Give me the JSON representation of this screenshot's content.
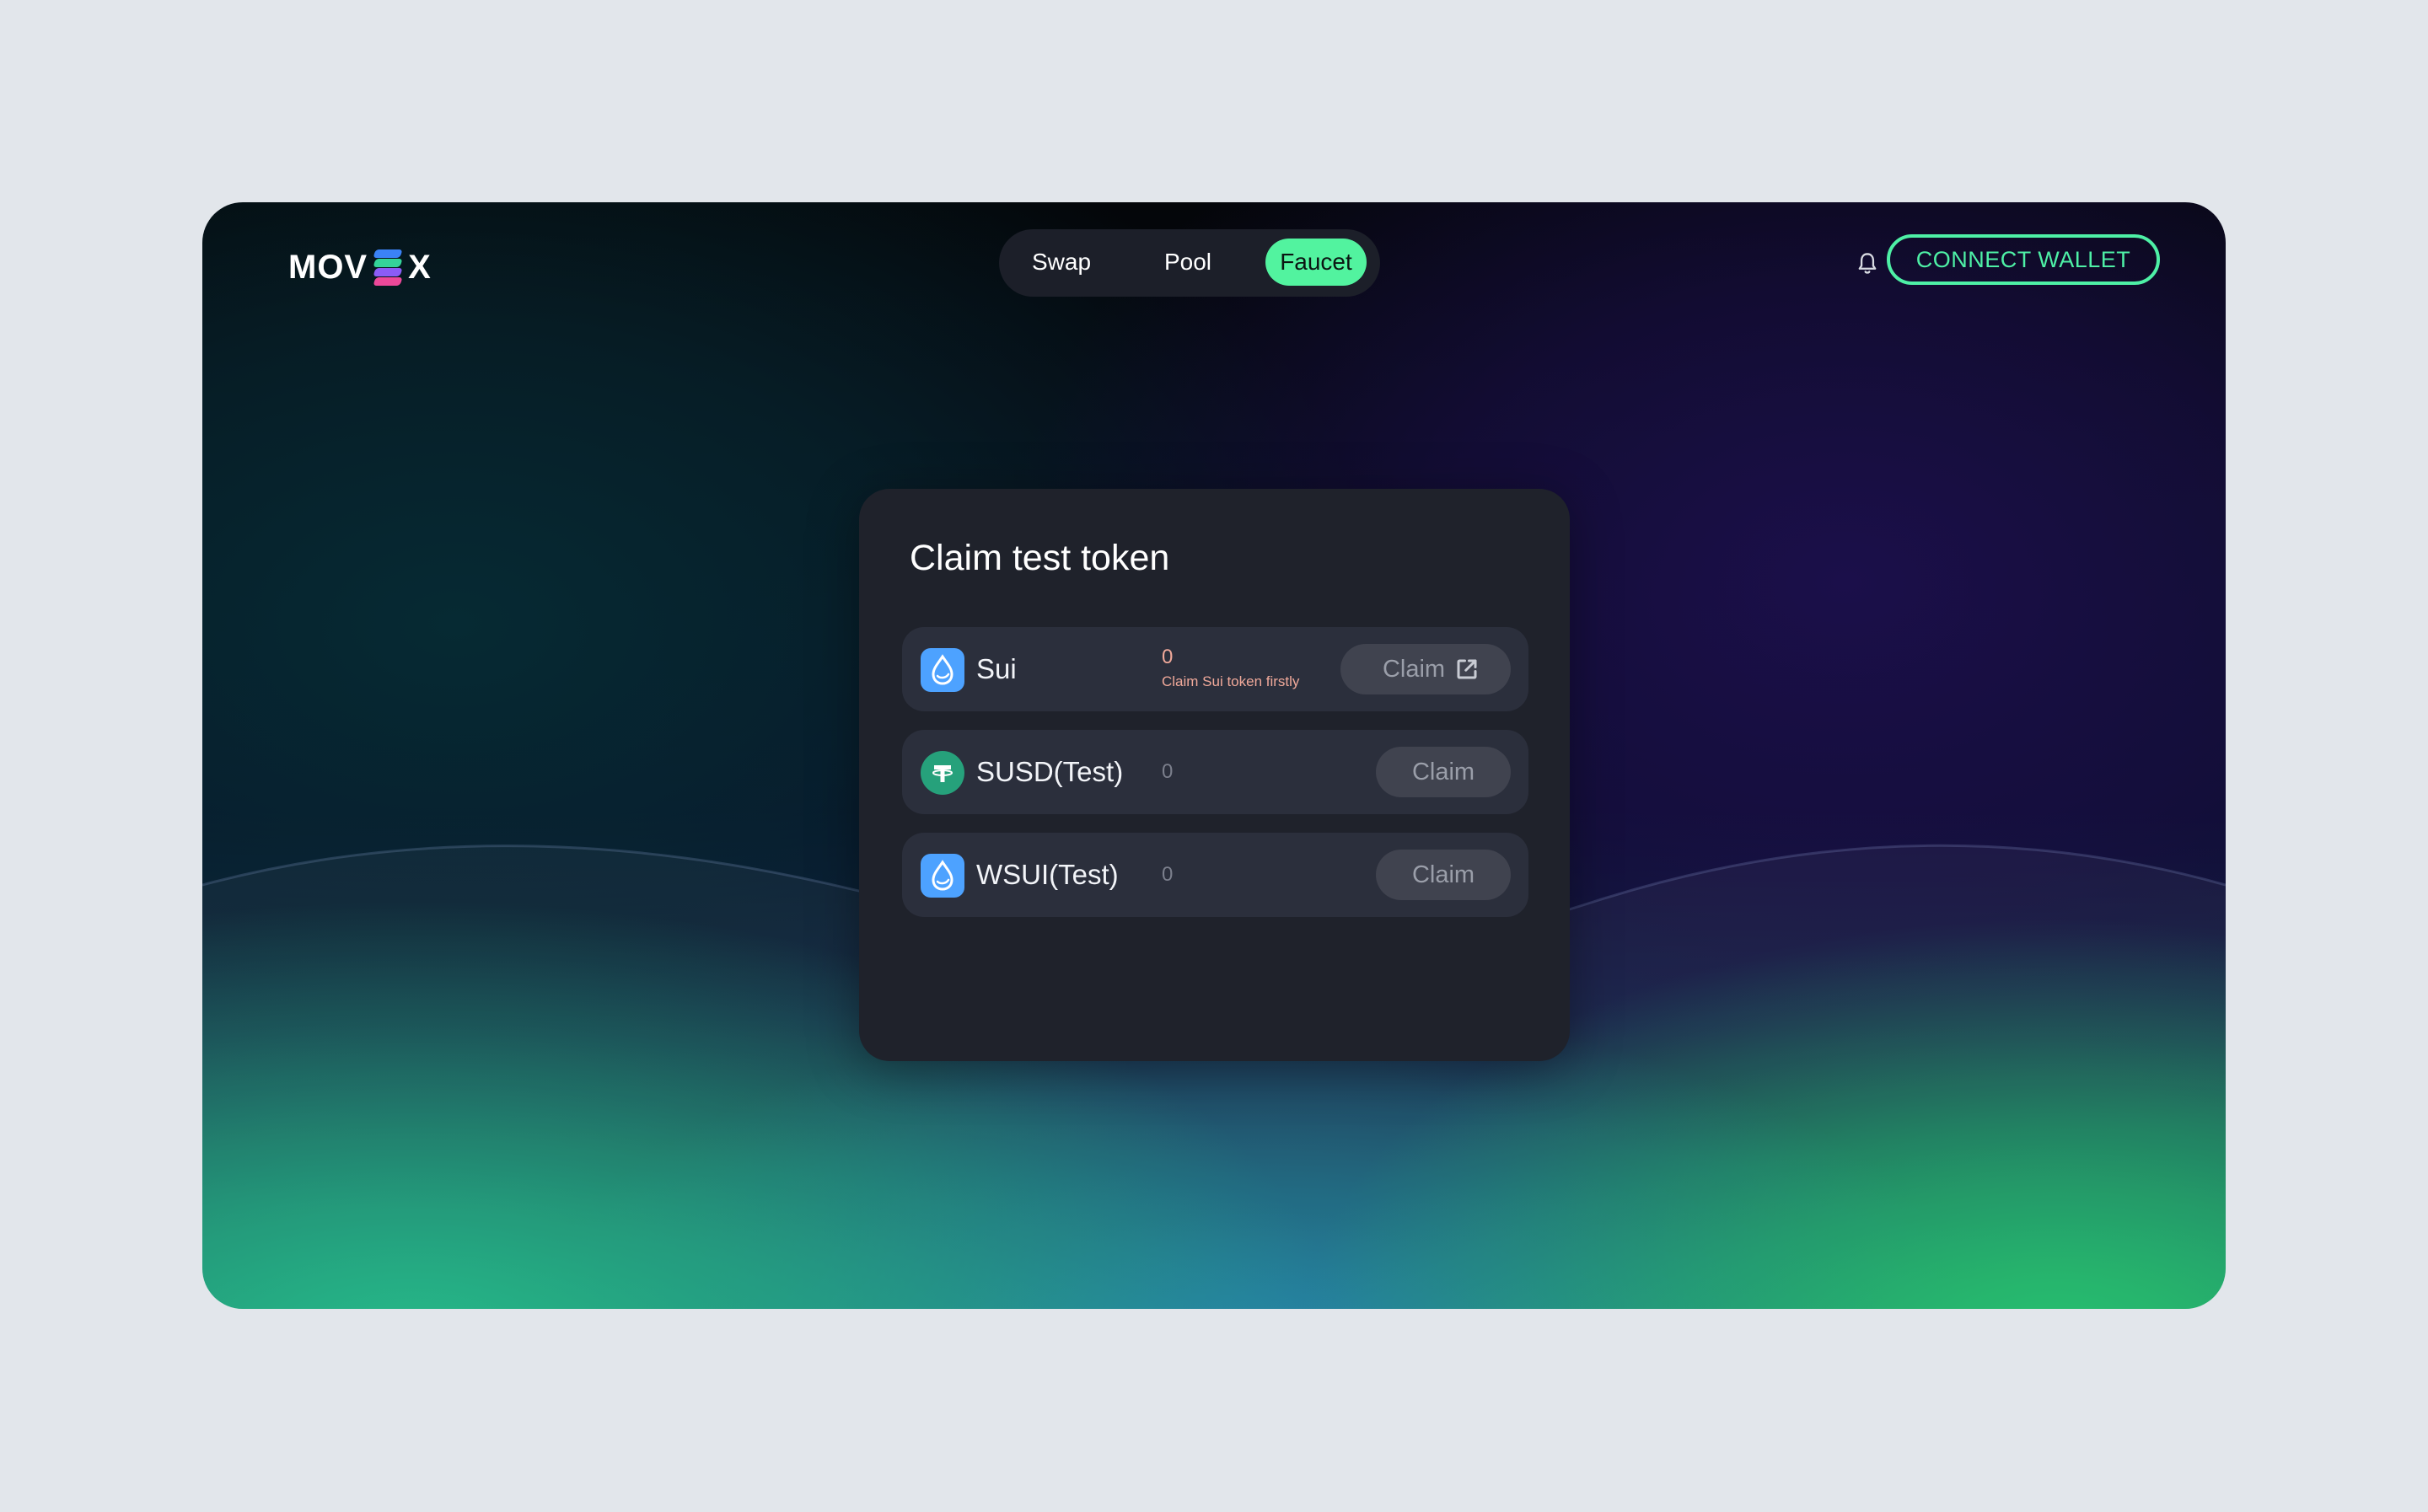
{
  "app": {
    "logo_text_left": "MOV",
    "logo_text_right": "X",
    "logo_mark_colors": [
      "#3b82f6",
      "#34d399",
      "#8b5cf6",
      "#ec4899"
    ]
  },
  "nav": {
    "items": [
      {
        "label": "Swap",
        "active": false
      },
      {
        "label": "Pool",
        "active": false
      },
      {
        "label": "Faucet",
        "active": true
      }
    ]
  },
  "header": {
    "bell_icon": "bell-icon",
    "connect_label": "CONNECT WALLET"
  },
  "faucet": {
    "title": "Claim test token",
    "tokens": [
      {
        "name": "Sui",
        "balance": "0",
        "hint": "Claim Sui token firstly",
        "claim_label": "Claim",
        "icon": "sui-droplet-icon",
        "action_icon": "external-link-icon"
      },
      {
        "name": "SUSD(Test)",
        "balance": "0",
        "claim_label": "Claim",
        "icon": "tether-icon"
      },
      {
        "name": "WSUI(Test)",
        "balance": "0",
        "claim_label": "Claim",
        "icon": "sui-droplet-icon"
      }
    ]
  },
  "colors": {
    "accent": "#52f39f",
    "connect_border": "#4ef0a6",
    "warning_text": "#f0a99a",
    "card_bg": "#1f222b",
    "row_bg": "#2b2f3c"
  }
}
